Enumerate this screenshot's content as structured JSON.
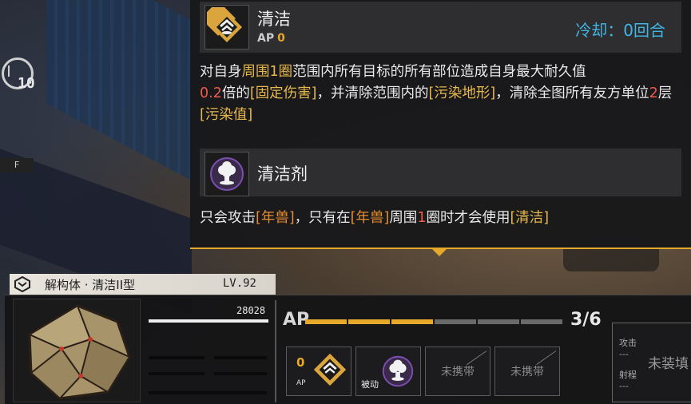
{
  "skill1": {
    "name": "清洁",
    "ap_tag": "AP",
    "ap_value": "0",
    "cooldown": "冷却：0回合",
    "desc_parts": {
      "p1": "对自身",
      "p2": "周围1圈",
      "p3": "范围内所有目标的所有部位造成自身最大耐久值",
      "p4": "0.2",
      "p5": "倍的",
      "p6": "[固定伤害]",
      "p7": "，并清除范围内的",
      "p8": "[污染地形]",
      "p9": "，清除全图所有友方单位",
      "p10": "2",
      "p11": "层",
      "p12": "[污染值]"
    }
  },
  "skill2": {
    "name": "清洁剂",
    "desc_parts": {
      "p1": "只会攻击",
      "p2": "[年兽]",
      "p3": "，只有在",
      "p4": "[年兽]",
      "p5": "周围",
      "p6": "1",
      "p7": "圈时才会使用",
      "p8": "[清洁]"
    }
  },
  "timer": {
    "value": "10",
    "key": "F"
  },
  "unit": {
    "name": "解构体 · 清洁II型",
    "level": "LV.92",
    "hp": "28028",
    "ap_label": "AP",
    "ap_count": "3/6",
    "ap_segments": [
      true,
      true,
      true,
      false,
      false,
      false
    ]
  },
  "slots": [
    {
      "type": "skill",
      "ap": "0",
      "ap_label": "AP"
    },
    {
      "type": "passive",
      "label": "被动"
    },
    {
      "type": "empty",
      "label": "未携带"
    },
    {
      "type": "empty",
      "label": "未携带"
    }
  ],
  "side": {
    "attack_label": "攻击",
    "attack_value": "---",
    "range_label": "射程",
    "range_value": "---",
    "status": "未装填"
  },
  "colors": {
    "accent_gold": "#e6a92b",
    "cooldown_blue": "#3fb6e6",
    "highlight_red": "#f05a4a",
    "highlight_yellow": "#e6b84a"
  }
}
